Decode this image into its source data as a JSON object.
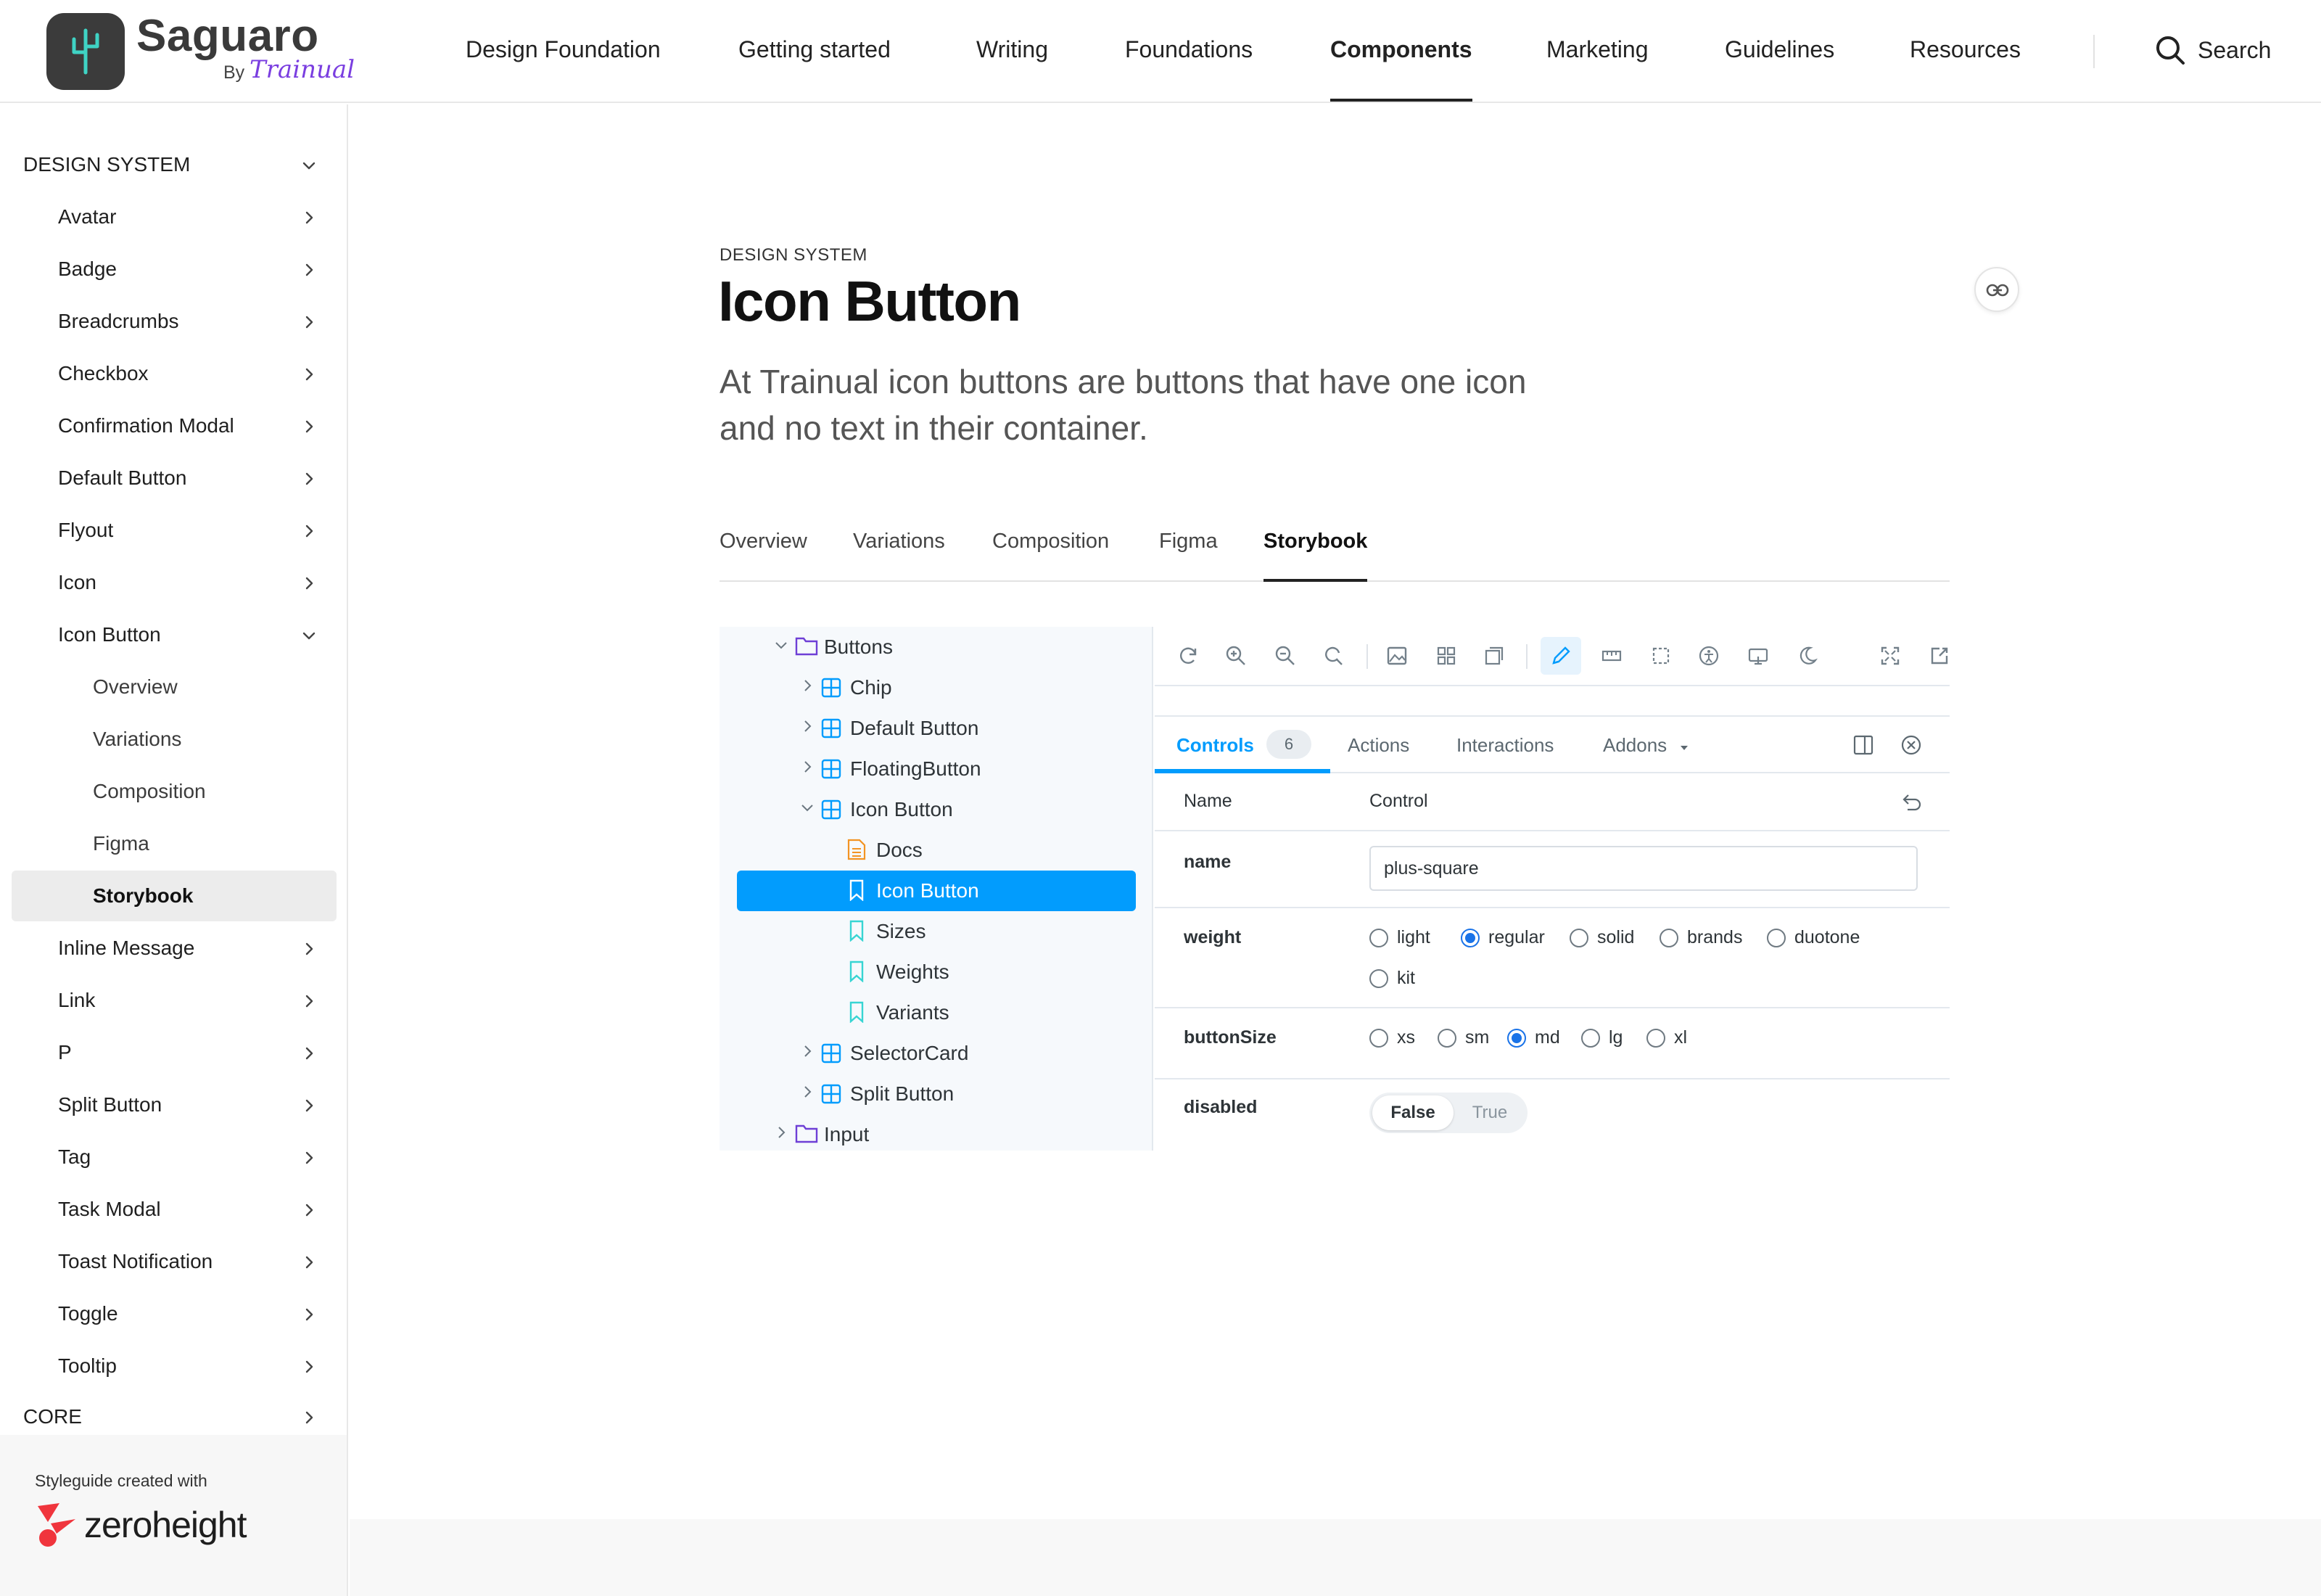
{
  "brand": {
    "name": "Saguaro",
    "by": "By",
    "sub": "Trainual"
  },
  "nav": {
    "items": [
      {
        "label": "Design Foundation"
      },
      {
        "label": "Getting started"
      },
      {
        "label": "Writing"
      },
      {
        "label": "Foundations"
      },
      {
        "label": "Components",
        "active": true
      },
      {
        "label": "Marketing"
      },
      {
        "label": "Guidelines"
      },
      {
        "label": "Resources"
      }
    ],
    "search_label": "Search"
  },
  "sidebar": {
    "section": "DESIGN SYSTEM",
    "items": [
      {
        "label": "Avatar"
      },
      {
        "label": "Badge"
      },
      {
        "label": "Breadcrumbs"
      },
      {
        "label": "Checkbox"
      },
      {
        "label": "Confirmation Modal"
      },
      {
        "label": "Default Button"
      },
      {
        "label": "Flyout"
      },
      {
        "label": "Icon"
      },
      {
        "label": "Icon Button"
      }
    ],
    "subitems": [
      {
        "label": "Overview"
      },
      {
        "label": "Variations"
      },
      {
        "label": "Composition"
      },
      {
        "label": "Figma"
      },
      {
        "label": "Storybook"
      }
    ],
    "items_after": [
      {
        "label": "Inline Message"
      },
      {
        "label": "Link"
      },
      {
        "label": "P"
      },
      {
        "label": "Split Button"
      },
      {
        "label": "Tag"
      },
      {
        "label": "Task Modal"
      },
      {
        "label": "Toast Notification"
      },
      {
        "label": "Toggle"
      },
      {
        "label": "Tooltip"
      }
    ],
    "next_section": "CORE",
    "footer_caption": "Styleguide created with",
    "footer_brand": "zeroheight"
  },
  "page": {
    "eyebrow": "DESIGN SYSTEM",
    "title": "Icon Button",
    "lead": "At Trainual icon buttons are buttons that have one icon and no text in their container.",
    "tabs": [
      {
        "label": "Overview"
      },
      {
        "label": "Variations"
      },
      {
        "label": "Composition"
      },
      {
        "label": "Figma"
      },
      {
        "label": "Storybook",
        "active": true
      }
    ]
  },
  "storybook": {
    "tree": [
      {
        "label": "Buttons",
        "type": "folder",
        "expanded": true
      },
      {
        "label": "Chip",
        "type": "component"
      },
      {
        "label": "Default Button",
        "type": "component"
      },
      {
        "label": "FloatingButton",
        "type": "component"
      },
      {
        "label": "Icon Button",
        "type": "component",
        "expanded": true
      },
      {
        "label": "Docs",
        "type": "docs"
      },
      {
        "label": "Icon Button",
        "type": "story",
        "selected": true
      },
      {
        "label": "Sizes",
        "type": "story"
      },
      {
        "label": "Weights",
        "type": "story"
      },
      {
        "label": "Variants",
        "type": "story"
      },
      {
        "label": "SelectorCard",
        "type": "component"
      },
      {
        "label": "Split Button",
        "type": "component"
      },
      {
        "label": "Input",
        "type": "folder"
      }
    ],
    "addon_tabs": {
      "controls": "Controls",
      "controls_count": "6",
      "actions": "Actions",
      "interactions": "Interactions",
      "addons": "Addons"
    },
    "controls_header": {
      "name": "Name",
      "control": "Control"
    },
    "controls": {
      "name": {
        "label": "name",
        "value": "plus-square"
      },
      "weight": {
        "label": "weight",
        "options": [
          "light",
          "regular",
          "solid",
          "brands",
          "duotone",
          "kit"
        ],
        "selected": "regular"
      },
      "buttonSize": {
        "label": "buttonSize",
        "options": [
          "xs",
          "sm",
          "md",
          "lg",
          "xl"
        ],
        "selected": "md"
      },
      "disabled": {
        "label": "disabled",
        "false_label": "False",
        "true_label": "True",
        "value": "False"
      }
    }
  },
  "colors": {
    "accent": "#029cfd",
    "logo_bg": "#3b3b3b",
    "logo_cactus": "#3fd3c4",
    "trainual_purple": "#7a3ee0",
    "zeroheight_red": "#f0353d"
  }
}
